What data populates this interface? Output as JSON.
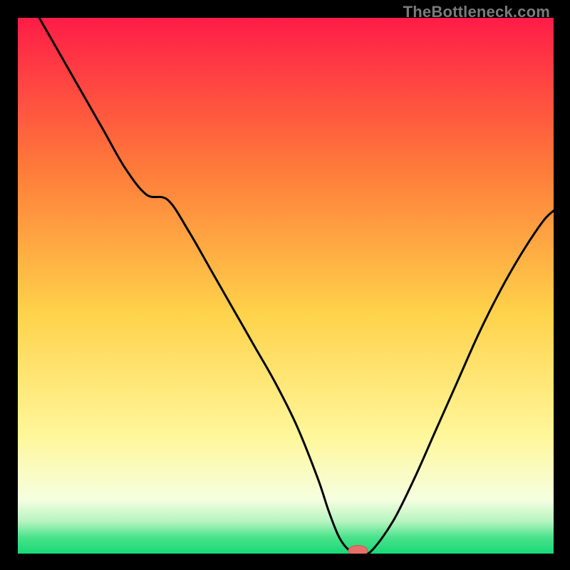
{
  "watermark": "TheBottleneck.com",
  "colors": {
    "black": "#000000",
    "curve": "#000000",
    "marker_fill": "#e86f6a",
    "marker_stroke": "#d0554f",
    "grad_top": "#ff1c47",
    "grad_mid_upper": "#ff7a3a",
    "grad_mid": "#ffd24a",
    "grad_lower_yellow": "#fff79a",
    "grad_pale": "#f5ffe0",
    "grad_green1": "#b6f4c0",
    "grad_green2": "#49e28a",
    "grad_green3": "#19d977"
  },
  "chart_data": {
    "type": "line",
    "title": "",
    "xlabel": "",
    "ylabel": "",
    "xlim": [
      0,
      100
    ],
    "ylim": [
      0,
      100
    ],
    "series": [
      {
        "name": "bottleneck-curve",
        "x": [
          4,
          8,
          12,
          16,
          20,
          24,
          28,
          32,
          36,
          40,
          44,
          48,
          52,
          56,
          58,
          60,
          62,
          64,
          66,
          70,
          74,
          78,
          82,
          86,
          90,
          94,
          98,
          100
        ],
        "y": [
          100,
          93,
          86,
          79,
          72,
          67,
          66,
          60,
          53,
          46,
          39,
          32,
          24,
          14,
          8,
          3,
          0.5,
          0,
          0.5,
          6,
          14,
          23,
          32,
          41,
          49,
          56,
          62,
          64
        ]
      }
    ],
    "flat_bottom": {
      "x_start": 60,
      "x_end": 66,
      "y": 0
    },
    "marker": {
      "x": 63.5,
      "y": 0,
      "rx": 1.8,
      "ry": 1.0
    }
  }
}
